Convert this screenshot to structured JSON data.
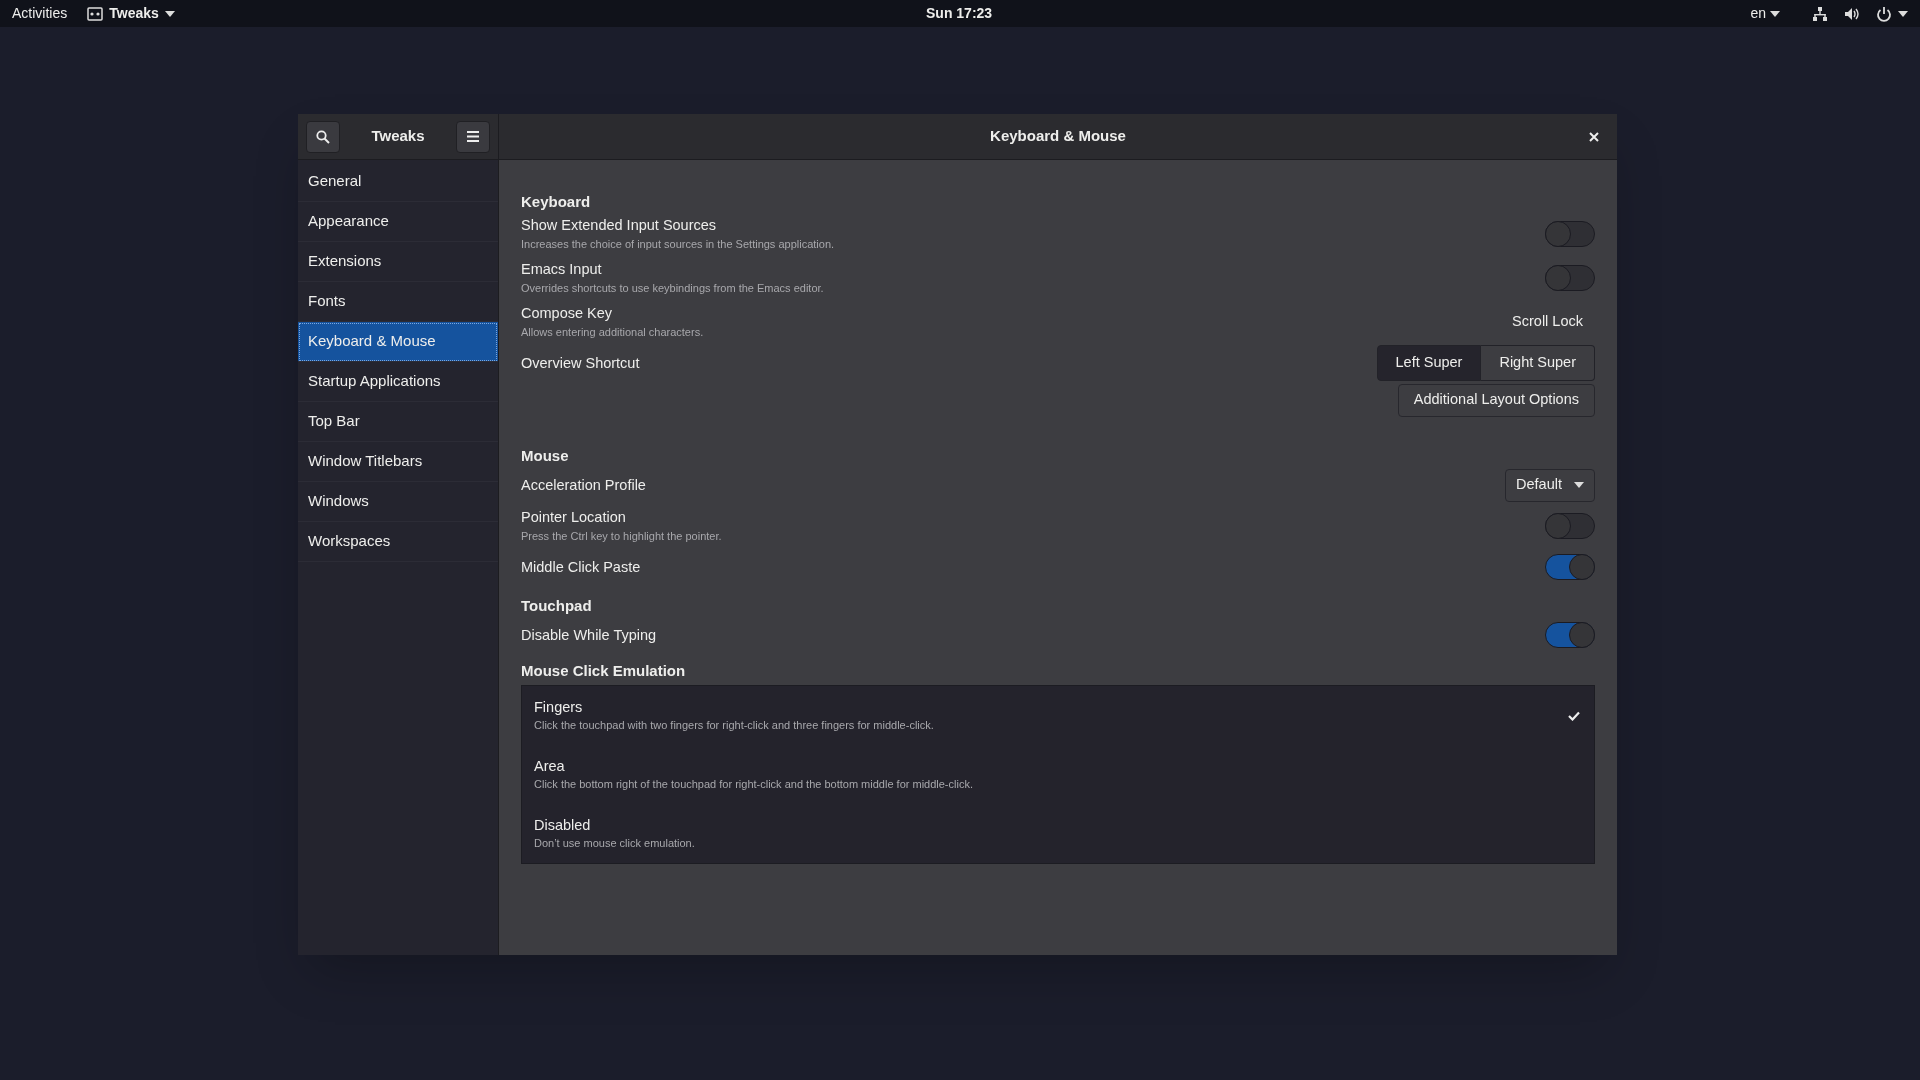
{
  "top_bar": {
    "activities": "Activities",
    "app_menu": "Tweaks",
    "clock": "Sun 17:23",
    "language": "en"
  },
  "window": {
    "title": "Keyboard & Mouse",
    "sidebar_title": "Tweaks"
  },
  "sidebar": {
    "items": [
      {
        "label": "General",
        "selected": false
      },
      {
        "label": "Appearance",
        "selected": false
      },
      {
        "label": "Extensions",
        "selected": false
      },
      {
        "label": "Fonts",
        "selected": false
      },
      {
        "label": "Keyboard & Mouse",
        "selected": true
      },
      {
        "label": "Startup Applications",
        "selected": false
      },
      {
        "label": "Top Bar",
        "selected": false
      },
      {
        "label": "Window Titlebars",
        "selected": false
      },
      {
        "label": "Windows",
        "selected": false
      },
      {
        "label": "Workspaces",
        "selected": false
      }
    ]
  },
  "sections": [
    {
      "heading": "Keyboard",
      "rows": [
        {
          "kind": "toggle",
          "label": "Show Extended Input Sources",
          "description": "Increases the choice of input sources in the Settings application.",
          "on": false
        },
        {
          "kind": "toggle",
          "label": "Emacs Input",
          "description": "Overrides shortcuts to use keybindings from the Emacs editor.",
          "on": false
        },
        {
          "kind": "value",
          "label": "Compose Key",
          "description": "Allows entering additional characters.",
          "value": "Scroll Lock"
        },
        {
          "kind": "segmented",
          "label": "Overview Shortcut",
          "options": [
            {
              "label": "Left Super",
              "selected": true
            },
            {
              "label": "Right Super",
              "selected": false
            }
          ]
        },
        {
          "kind": "button",
          "value": "Additional Layout Options"
        }
      ]
    },
    {
      "heading": "Mouse",
      "rows": [
        {
          "kind": "dropdown",
          "label": "Acceleration Profile",
          "value": "Default"
        },
        {
          "kind": "toggle",
          "label": "Pointer Location",
          "description": "Press the Ctrl key to highlight the pointer.",
          "on": false
        },
        {
          "kind": "toggle",
          "label": "Middle Click Paste",
          "on": true
        }
      ]
    },
    {
      "heading": "Touchpad",
      "rows": [
        {
          "kind": "toggle",
          "label": "Disable While Typing",
          "on": true
        }
      ]
    }
  ],
  "click_emulation": {
    "heading": "Mouse Click Emulation",
    "options": [
      {
        "label": "Fingers",
        "description": "Click the touchpad with two fingers for right-click and three fingers for middle-click.",
        "selected": true
      },
      {
        "label": "Area",
        "description": "Click the bottom right of the touchpad for right-click and the bottom middle for middle-click.",
        "selected": false
      },
      {
        "label": "Disabled",
        "description": "Don’t use mouse click emulation.",
        "selected": false
      }
    ]
  }
}
